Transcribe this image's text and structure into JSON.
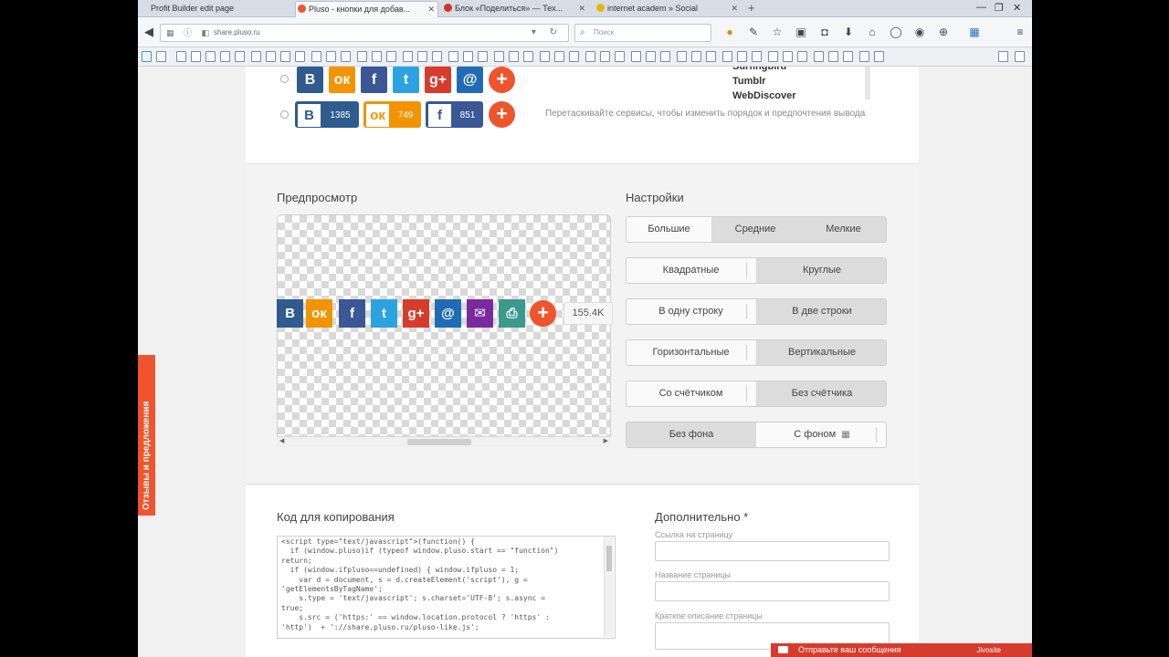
{
  "browser": {
    "tabs": [
      {
        "label": "Profit Builder edit page",
        "color": "#cccccc"
      },
      {
        "label": "Pluso - кнопки для добав...",
        "color": "#f0542d"
      },
      {
        "label": "Блок «Поделиться» — Тех...",
        "color": "#d93025"
      },
      {
        "label": "internet academ » Social",
        "color": "#e7b800"
      }
    ],
    "new_tab": "+",
    "url": "share.pluso.ru",
    "search_placeholder": "Поиск"
  },
  "services_list": {
    "items": [
      "Surfingbird",
      "Tumblr",
      "WebDiscover"
    ]
  },
  "button_styles": {
    "row1": [
      {
        "icon": "В",
        "color": "#2f5b8e"
      },
      {
        "icon": "ок",
        "color": "#f29400"
      },
      {
        "icon": "f",
        "color": "#3a5796"
      },
      {
        "icon": "t",
        "color": "#2aa3e0"
      },
      {
        "icon": "g+",
        "color": "#d73b2c"
      },
      {
        "icon": "@",
        "color": "#1f6cb5"
      }
    ],
    "row2": [
      {
        "icon": "В",
        "count": "1385",
        "color": "#2f5b8e"
      },
      {
        "icon": "ок",
        "count": "749",
        "color": "#f29400"
      },
      {
        "icon": "f",
        "count": "851",
        "color": "#3a5796"
      }
    ],
    "plus": "+",
    "hint": "Перетаскивайте сервисы, чтобы изменить порядок и предпочтения вывода"
  },
  "preview": {
    "title": "Предпросмотр",
    "buttons": [
      {
        "icon": "В",
        "color": "#2f5b8e"
      },
      {
        "icon": "ок",
        "color": "#f29400"
      },
      {
        "icon": "f",
        "color": "#3a5796"
      },
      {
        "icon": "t",
        "color": "#2aa3e0"
      },
      {
        "icon": "g+",
        "color": "#d73b2c"
      },
      {
        "icon": "@",
        "color": "#1f6cb5"
      },
      {
        "icon": "✉",
        "color": "#7b2a9e"
      },
      {
        "icon": "⎙",
        "color": "#3a9a8c"
      }
    ],
    "plus": "+",
    "counter": "155.4K"
  },
  "settings": {
    "title": "Настройки",
    "size": [
      "Большие",
      "Средние",
      "Мелкие"
    ],
    "shape": [
      "Квадратные",
      "Круглые"
    ],
    "rows": [
      "В одну строку",
      "В две строки"
    ],
    "orientation": [
      "Горизонтальные",
      "Вертикальные"
    ],
    "counter": [
      "Со счётчиком",
      "Без счётчика"
    ],
    "background": [
      "Без фона",
      "С фоном"
    ]
  },
  "code": {
    "title": "Код для копирования",
    "text": "<script type=\"text/javascript\">(function() {\n  if (window.pluso)if (typeof window.pluso.start == \"function\")\nreturn;\n  if (window.ifpluso==undefined) { window.ifpluso = 1;\n    var d = document, s = d.createElement('script'), g =\n'getElementsByTagName';\n    s.type = 'text/javascript'; s.charset='UTF-8'; s.async =\ntrue;\n    s.src = ('https:' == window.location.protocol ? 'https' :\n'http')  + '://share.pluso.ru/pluso-like.js';"
  },
  "extra": {
    "title": "Дополнительно *",
    "fields": [
      "Ссылка на страницу",
      "Название страницы",
      "Краткое описание страницы"
    ]
  },
  "feedback_tab": "Отзывы и предложения",
  "chat": {
    "label": "Отправьте ваш сообщения",
    "right": "Jivosite"
  }
}
